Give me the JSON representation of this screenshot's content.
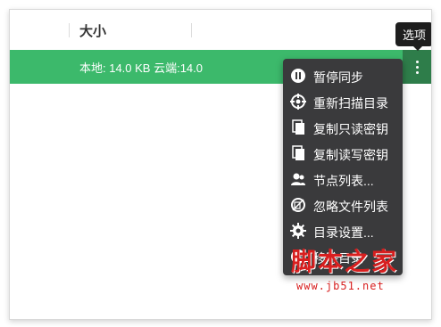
{
  "header": {
    "size_column_label": "大小"
  },
  "row": {
    "size_text": "本地: 14.0 KB 云端:14.0"
  },
  "options_tooltip": "选项",
  "menu": {
    "items": [
      {
        "label": "暂停同步",
        "icon": "pause-icon"
      },
      {
        "label": "重新扫描目录",
        "icon": "crosshair-icon"
      },
      {
        "label": "复制只读密钥",
        "icon": "copy-icon"
      },
      {
        "label": "复制读写密钥",
        "icon": "copy-icon"
      },
      {
        "label": "节点列表...",
        "icon": "users-icon"
      },
      {
        "label": "忽略文件列表",
        "icon": "ignore-icon"
      },
      {
        "label": "目录设置...",
        "icon": "gear-icon"
      },
      {
        "label": "移除目录",
        "icon": "minus-circle-icon"
      }
    ]
  },
  "watermark": {
    "title": "脚本之家",
    "url": "www.jb51.net"
  },
  "colors": {
    "row_green": "#3cb96b",
    "kebab_green": "#2e7d4a",
    "menu_bg": "#3a3a3c",
    "watermark_red": "#d81f1f"
  }
}
